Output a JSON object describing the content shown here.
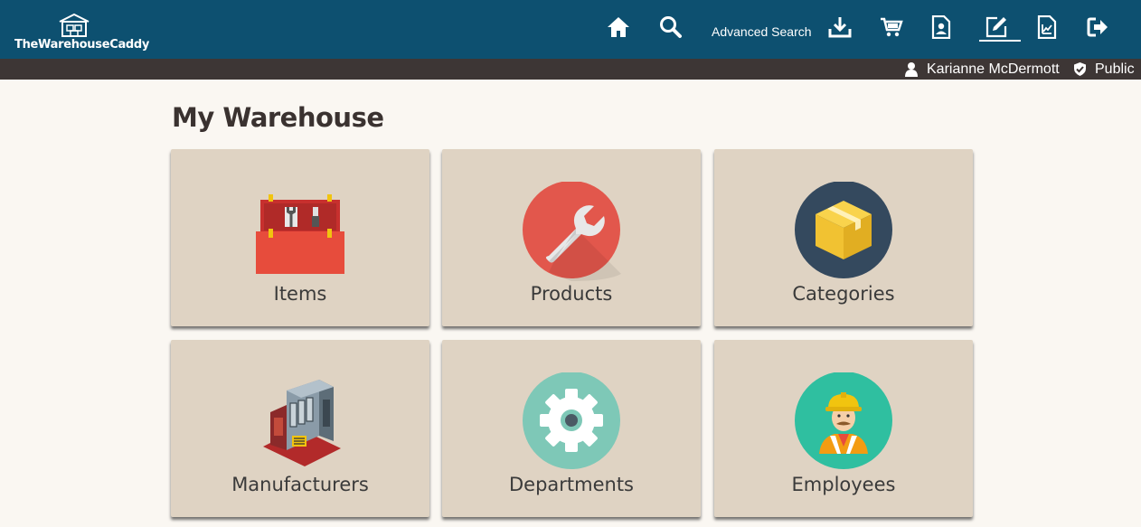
{
  "app": {
    "name": "TheWarehouseCaddy"
  },
  "nav": {
    "advanced_search_label": "Advanced Search",
    "icons": [
      "home-icon",
      "search-icon",
      "download-icon",
      "cart-icon",
      "profile-document-icon",
      "edit-icon",
      "report-chart-icon",
      "logout-icon"
    ]
  },
  "user": {
    "name": "Karianne McDermott",
    "visibility": "Public"
  },
  "page": {
    "title": "My Warehouse"
  },
  "tiles": [
    {
      "label": "Items",
      "icon": "toolbox-icon"
    },
    {
      "label": "Products",
      "icon": "wrench-icon"
    },
    {
      "label": "Categories",
      "icon": "box-icon"
    },
    {
      "label": "Manufacturers",
      "icon": "factory-icon"
    },
    {
      "label": "Departments",
      "icon": "gear-icon"
    },
    {
      "label": "Employees",
      "icon": "worker-icon"
    }
  ],
  "colors": {
    "header": "#0d5070",
    "userbar": "#3d3635",
    "tile": "#dfd3c3",
    "background": "#faf7f2"
  }
}
